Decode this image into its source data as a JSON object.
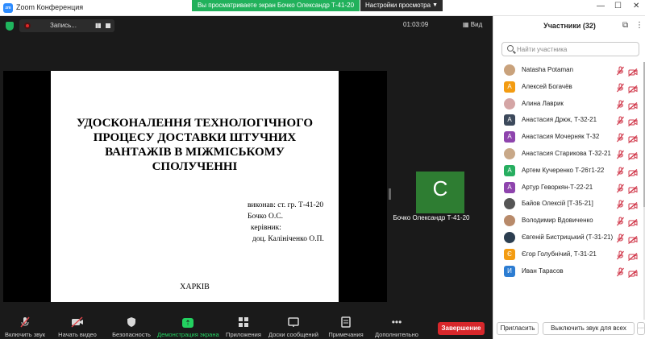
{
  "window": {
    "logo": "zoom",
    "title": "Zoom Конференция",
    "share_banner": "Вы просматриваете экран Бочко Олександр Т-41-20",
    "view_options": "Настройки просмотра",
    "minimize": "—",
    "maximize": "☐",
    "close": "✕"
  },
  "meeting_top": {
    "recording_label": "Запись...",
    "pause_icon": "▮▮",
    "timer": "01:03:09",
    "view_label": "Вид"
  },
  "slide": {
    "title": "УДОСКОНАЛЕННЯ ТЕХНОЛОГІЧНОГО ПРОЦЕСУ ДОСТАВКИ ШТУЧНИХ ВАНТАЖІВ В МІЖМІСЬКОМУ СПОЛУЧЕННІ",
    "line1": "виконав: ст. гр. Т-41-20",
    "line2": "Бочко О.С.",
    "line3": "керівник:",
    "line4": "доц. Калініченко О.П.",
    "city": "ХАРКІВ"
  },
  "video": {
    "initial": "С",
    "name": "Бочко Олександр Т-41-20",
    "tile_color": "#2e7d32"
  },
  "toolbar": {
    "items": [
      {
        "label": "Включить звук",
        "icon": "mic-muted-icon"
      },
      {
        "label": "Начать видео",
        "icon": "camera-off-icon"
      },
      {
        "label": "Безопасность",
        "icon": "shield-icon"
      },
      {
        "label": "Демонстрация экрана",
        "icon": "share-screen-icon"
      },
      {
        "label": "Приложения",
        "icon": "apps-icon"
      },
      {
        "label": "Доски сообщений",
        "icon": "whiteboard-icon"
      },
      {
        "label": "Примечания",
        "icon": "notes-icon"
      },
      {
        "label": "Дополнительно",
        "icon": "more-icon"
      }
    ],
    "end_label": "Завершение",
    "active_color": "#23d160",
    "end_color": "#d7272b"
  },
  "panel": {
    "title": "Участники (32)",
    "search_placeholder": "Найти участника",
    "participants": [
      {
        "name": "Natasha Potaman",
        "avatar": "photo",
        "initial": "",
        "color": "#c9a27c"
      },
      {
        "name": "Алексей Богачёв",
        "avatar": "letter",
        "initial": "А",
        "color": "#f39c12"
      },
      {
        "name": "Алина Лаврик",
        "avatar": "photo",
        "initial": "",
        "color": "#d4a5a5"
      },
      {
        "name": "Анастасия Дрюк, Т-32-21",
        "avatar": "letter",
        "initial": "А",
        "color": "#3d4a5c"
      },
      {
        "name": "Анастасия Мочерняк Т-32",
        "avatar": "letter",
        "initial": "А",
        "color": "#8e44ad"
      },
      {
        "name": "Анастасия Старикова Т-32-21",
        "avatar": "photo",
        "initial": "",
        "color": "#c8a888"
      },
      {
        "name": "Артем Кучеренко Т-26т1-22",
        "avatar": "letter",
        "initial": "А",
        "color": "#27ae60"
      },
      {
        "name": "Артур Геворкян-Т-22-21",
        "avatar": "letter",
        "initial": "А",
        "color": "#8e44ad"
      },
      {
        "name": "Байов Олексій [Т-35-21]",
        "avatar": "photo",
        "initial": "",
        "color": "#555555"
      },
      {
        "name": "Володимир Вдовиченко",
        "avatar": "photo",
        "initial": "",
        "color": "#b88a6a"
      },
      {
        "name": "Євгеній Бистрицький (Т-31-21)",
        "avatar": "photo",
        "initial": "",
        "color": "#2c3e50"
      },
      {
        "name": "Єгор Голубнічий, Т-31-21",
        "avatar": "letter",
        "initial": "Є",
        "color": "#f39c12"
      },
      {
        "name": "Иван Тарасов",
        "avatar": "letter",
        "initial": "И",
        "color": "#2d7dd2"
      }
    ],
    "invite_label": "Пригласить",
    "mute_all_label": "Выключить звук для всех",
    "more_label": "···"
  }
}
